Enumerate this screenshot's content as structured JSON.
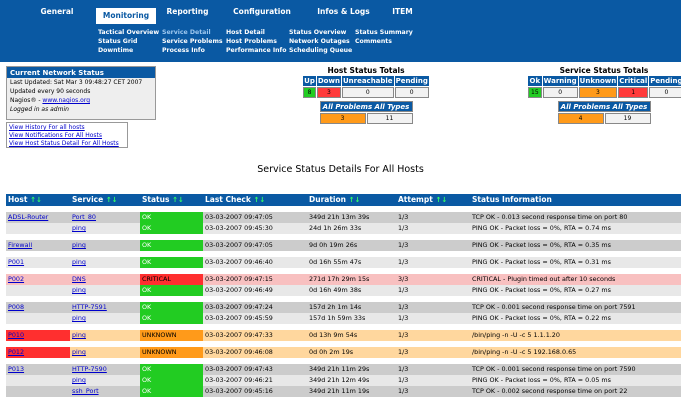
{
  "nav": {
    "tabs": [
      {
        "label": "General"
      },
      {
        "label": "Monitoring"
      },
      {
        "label": "Reporting"
      },
      {
        "label": "Configuration"
      },
      {
        "label": "Infos & Logs"
      },
      {
        "label": "ITEM"
      }
    ],
    "sub": [
      [
        "Tactical Overview",
        "Status Grid",
        "Downtime"
      ],
      [
        "Service Detail",
        "Service Problems",
        "Process Info"
      ],
      [
        "Host Detail",
        "Host Problems",
        "Performance Info"
      ],
      [
        "Status Overview",
        "Network Outages",
        "Scheduling Queue"
      ],
      [
        "Status Summary",
        "Comments"
      ]
    ]
  },
  "current": {
    "title": "Current Network Status",
    "updated": "Last Updated: Sat Mar 3 09:48:27 CET 2007",
    "interval": "Updated every 90 seconds",
    "nagios_prefix": "Nagios® - ",
    "nagios_link": "www.nagios.org",
    "logged": "Logged in as admin"
  },
  "links": [
    "View History For all hosts",
    "View Notifications For All Hosts",
    "View Host Status Detail For All Hosts"
  ],
  "host_totals": {
    "title": "Host Status Totals",
    "headers": [
      "Up",
      "Down",
      "Unreachable",
      "Pending"
    ],
    "values": [
      "8",
      "3",
      "0",
      "0"
    ],
    "all_label": "All Problems All Types",
    "all_values": [
      "3",
      "11"
    ]
  },
  "service_totals": {
    "title": "Service Status Totals",
    "headers": [
      "Ok",
      "Warning",
      "Unknown",
      "Critical",
      "Pending"
    ],
    "values": [
      "15",
      "0",
      "3",
      "1",
      "0"
    ],
    "all_label": "All Problems All Types",
    "all_values": [
      "4",
      "19"
    ]
  },
  "service_title": "Service Status Details For All Hosts",
  "columns": [
    "Host",
    "Service",
    "Status",
    "Last Check",
    "Duration",
    "Attempt",
    "Status Information"
  ],
  "rows": [
    {
      "host": "ADSL-Router",
      "service": "Port_80",
      "status": "OK",
      "check": "03-03-2007 09:47:05",
      "dur": "349d 21h 13m 39s",
      "att": "1/3",
      "info": "TCP OK - 0.013 second response time on port 80"
    },
    {
      "host": "",
      "service": "ping",
      "status": "OK",
      "check": "03-03-2007 09:45:30",
      "dur": "24d 1h 26m 33s",
      "att": "1/3",
      "info": "PING OK - Packet loss = 0%, RTA = 0.74 ms"
    },
    {
      "host": "Firewall",
      "service": "ping",
      "status": "OK",
      "check": "03-03-2007 09:47:05",
      "dur": "9d 0h 19m 26s",
      "att": "1/3",
      "info": "PING OK - Packet loss = 0%, RTA = 0.35 ms"
    },
    {
      "host": "P001",
      "service": "ping",
      "status": "OK",
      "check": "03-03-2007 09:46:40",
      "dur": "0d 16h 55m 47s",
      "att": "1/3",
      "info": "PING OK - Packet loss = 0%, RTA = 0.31 ms"
    },
    {
      "host": "P002",
      "service": "DNS",
      "status": "CRITICAL",
      "check": "03-03-2007 09:47:15",
      "dur": "271d 17h 29m 15s",
      "att": "3/3",
      "info": "CRITICAL - Plugin timed out after 10 seconds"
    },
    {
      "host": "",
      "service": "ping",
      "status": "OK",
      "check": "03-03-2007 09:46:49",
      "dur": "0d 16h 49m 38s",
      "att": "1/3",
      "info": "PING OK - Packet loss = 0%, RTA = 0.27 ms"
    },
    {
      "host": "P008",
      "service": "HTTP-7591",
      "status": "OK",
      "check": "03-03-2007 09:47:24",
      "dur": "157d 2h 1m 14s",
      "att": "1/3",
      "info": "TCP OK - 0.001 second response time on port 7591"
    },
    {
      "host": "",
      "service": "ping",
      "status": "OK",
      "check": "03-03-2007 09:45:59",
      "dur": "157d 1h 59m 33s",
      "att": "1/3",
      "info": "PING OK - Packet loss = 0%, RTA = 0.22 ms"
    },
    {
      "host": "P010",
      "service": "ping",
      "status": "UNKNOWN",
      "check": "03-03-2007 09:47:33",
      "dur": "0d 13h 9m 54s",
      "att": "1/3",
      "info": "/bin/ping -n -U -c 5 1.1.1.20"
    },
    {
      "host": "P012",
      "service": "ping",
      "status": "UNKNOWN",
      "check": "03-03-2007 09:46:08",
      "dur": "0d 0h 2m 19s",
      "att": "1/3",
      "info": "/bin/ping -n -U -c 5 192.168.0.65"
    },
    {
      "host": "P013",
      "service": "HTTP-7590",
      "status": "OK",
      "check": "03-03-2007 09:47:43",
      "dur": "349d 21h 11m 29s",
      "att": "1/3",
      "info": "TCP OK - 0.001 second response time on port 7590"
    },
    {
      "host": "",
      "service": "ping",
      "status": "OK",
      "check": "03-03-2007 09:46:21",
      "dur": "349d 21h 12m 49s",
      "att": "1/3",
      "info": "PING OK - Packet loss = 0%, RTA = 0.05 ms"
    },
    {
      "host": "",
      "service": "ssh_Port",
      "status": "OK",
      "check": "03-03-2007 09:45:16",
      "dur": "349d 21h 11m 19s",
      "att": "1/3",
      "info": "TCP OK - 0.002 second response time on port 22"
    }
  ]
}
